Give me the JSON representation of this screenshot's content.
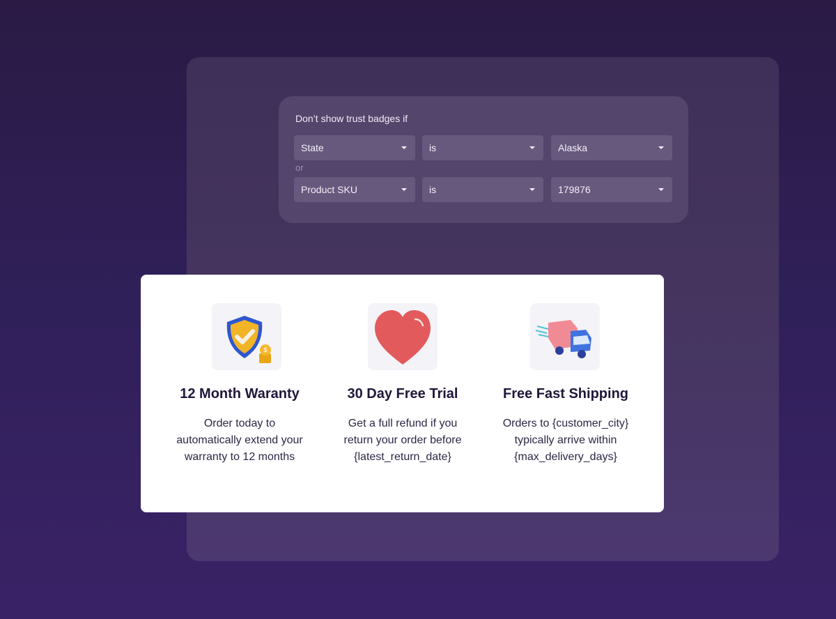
{
  "rules": {
    "title": "Don’t show trust badges if",
    "connector": "or",
    "conditions": [
      {
        "field": "State",
        "operator": "is",
        "value": "Alaska"
      },
      {
        "field": "Product SKU",
        "operator": "is",
        "value": "179876"
      }
    ]
  },
  "badges": [
    {
      "icon": "shield-check-icon",
      "title": "12 Month Waranty",
      "desc": [
        "Order today to",
        "automatically extend your",
        "warranty to 12 months"
      ]
    },
    {
      "icon": "heart-icon",
      "title": "30 Day Free Trial",
      "desc": [
        "Get a full refund if you",
        "return your order before",
        "{latest_return_date}"
      ]
    },
    {
      "icon": "delivery-truck-icon",
      "title": "Free Fast Shipping",
      "desc": [
        "Orders to {customer_city}",
        "typically arrive within",
        "{max_delivery_days}"
      ]
    }
  ]
}
